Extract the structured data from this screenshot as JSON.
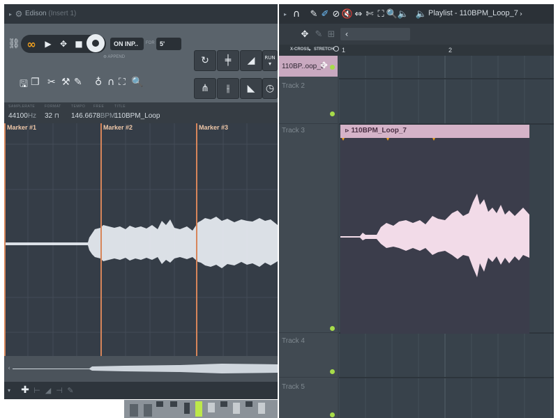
{
  "edison": {
    "title": "Edison",
    "subtitle": "(Insert 1)",
    "record_mode": "ON INP..",
    "for_value": "5'",
    "for_label": "FOR",
    "append_label": "APPEND",
    "run_label": "RUN",
    "info": {
      "samplerate_label": "SAMPLERATE",
      "samplerate_value": "44100",
      "samplerate_unit": "Hz",
      "format_label": "FORMAT",
      "format_value": "32",
      "tempo_label": "TEMPO",
      "tempo_value": "146.6678",
      "tempo_unit": "BPM",
      "free_label": "FREE",
      "title_label": "TITLE",
      "title_value": "110BPM_Loop"
    },
    "markers": [
      {
        "label": "Marker #1"
      },
      {
        "label": "Marker #2"
      },
      {
        "label": "Marker #3"
      }
    ]
  },
  "playlist": {
    "title": "Playlist - 110BPM_Loop_7",
    "crossfade_label": "X-CROSS",
    "stretch_label": "STRETCH",
    "bar_numbers": [
      "1",
      "2"
    ],
    "tracks": [
      {
        "name": "110BP..oop_5"
      },
      {
        "name": "Track 2"
      },
      {
        "name": "Track 3"
      },
      {
        "name": "Track 4"
      },
      {
        "name": "Track 5"
      }
    ],
    "clip": {
      "name": "110BPM_Loop_7"
    }
  },
  "colors": {
    "marker": "#d7855a",
    "accent": "#f0a020",
    "clip": "#d5b3c8",
    "waveform_playlist": "#f2dbe8",
    "waveform_edison": "#e9eef4",
    "track_dot": "#a7dc4a"
  }
}
